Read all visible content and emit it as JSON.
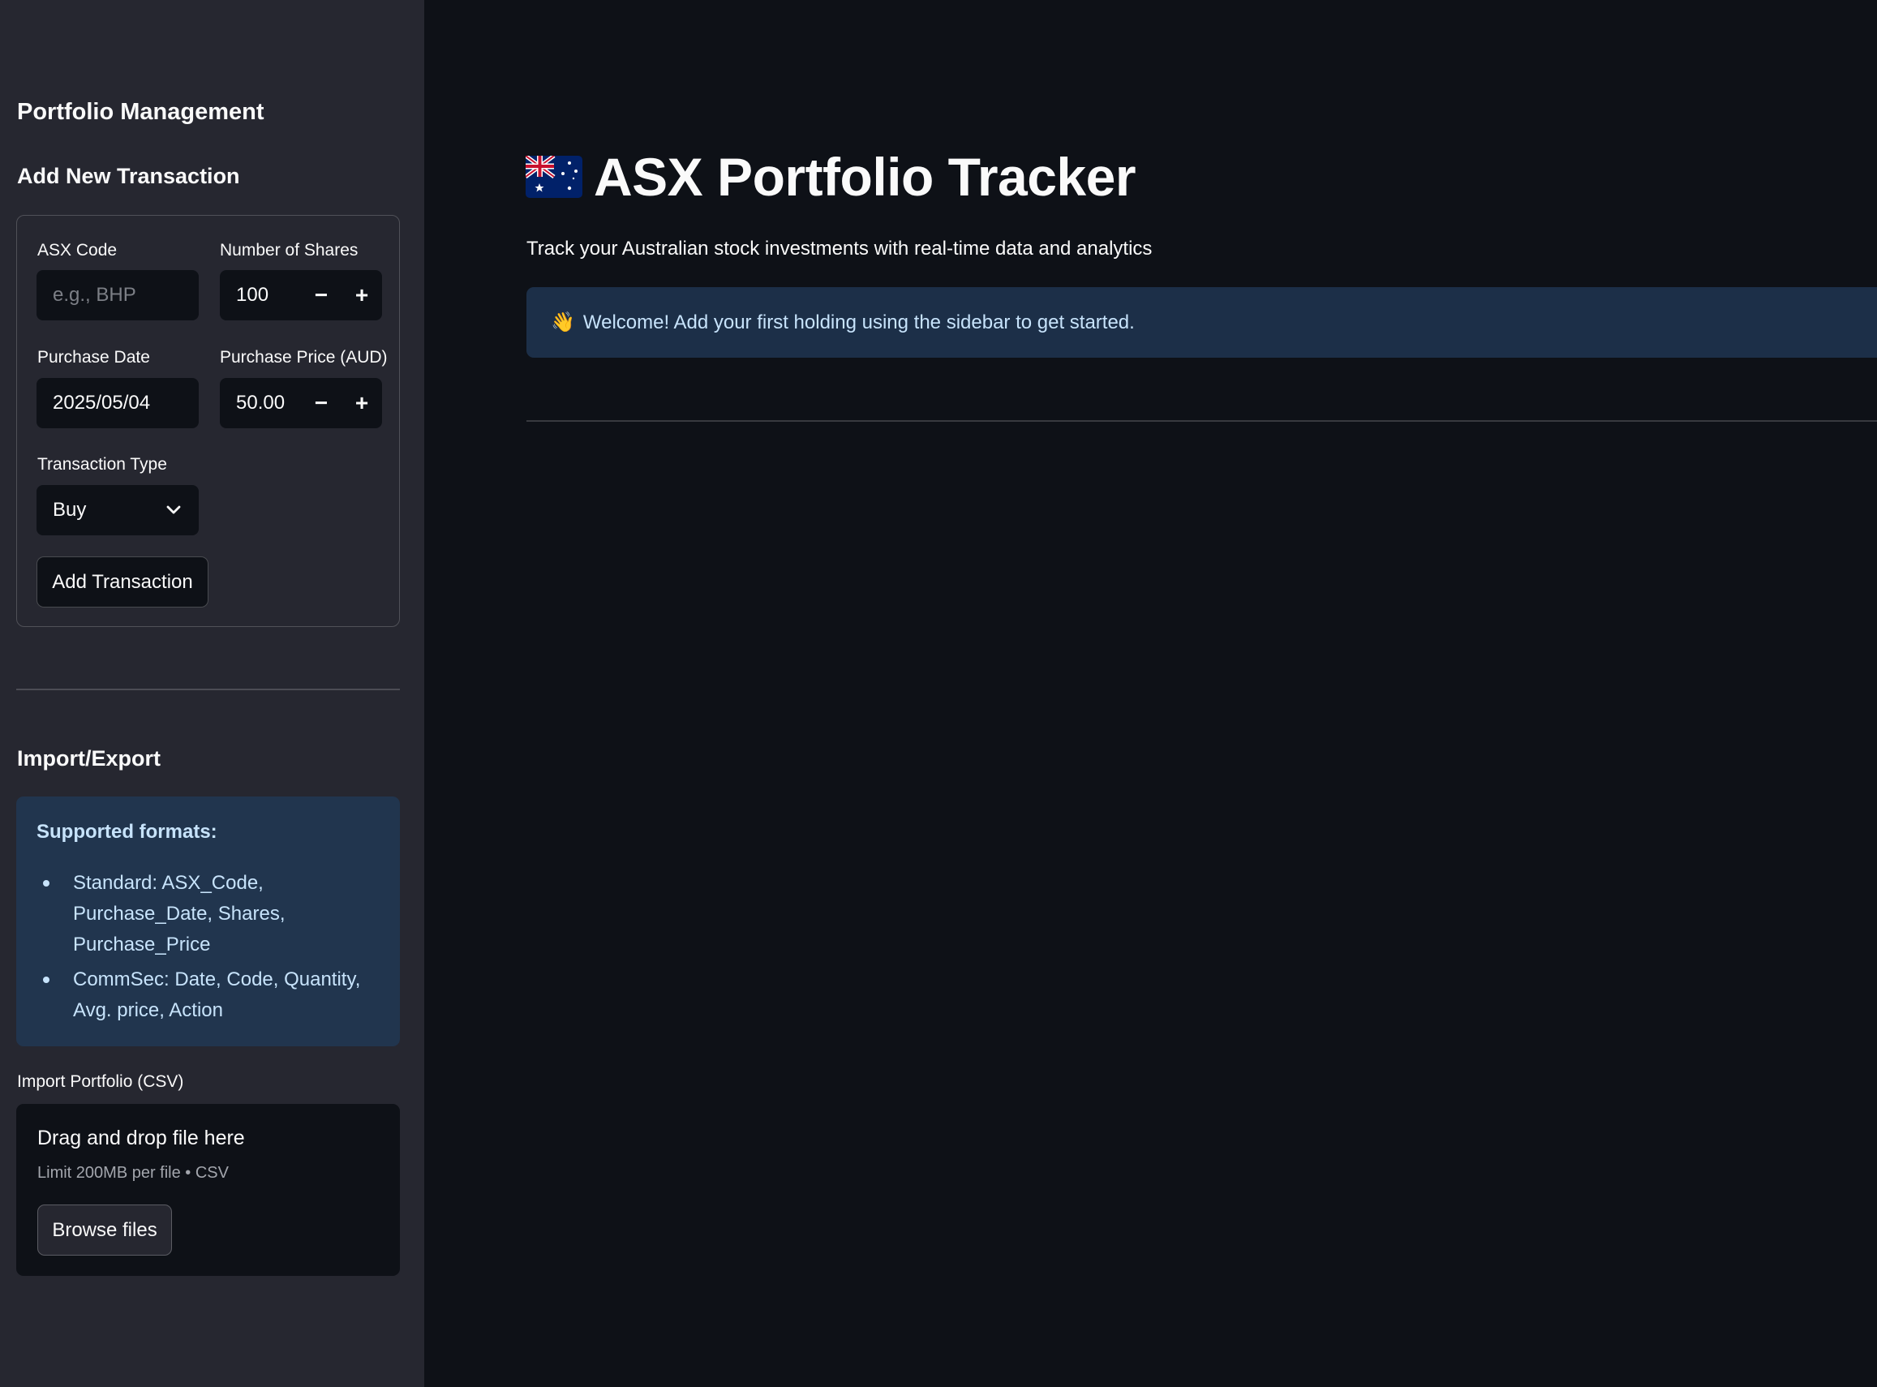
{
  "sidebar": {
    "title": "Portfolio Management",
    "add_section_title": "Add New Transaction",
    "form": {
      "asx_code": {
        "label": "ASX Code",
        "placeholder": "e.g., BHP",
        "value": ""
      },
      "shares": {
        "label": "Number of Shares",
        "value": "100",
        "minus": "−",
        "plus": "+"
      },
      "purchase_date": {
        "label": "Purchase Date",
        "value": "2025/05/04"
      },
      "purchase_price": {
        "label": "Purchase Price (AUD)",
        "value": "50.00",
        "minus": "−",
        "plus": "+"
      },
      "transaction_type": {
        "label": "Transaction Type",
        "value": "Buy"
      },
      "submit_label": "Add Transaction"
    },
    "import_export": {
      "title": "Import/Export",
      "info_heading": "Supported formats:",
      "formats": [
        "Standard: ASX_Code, Purchase_Date, Shares, Purchase_Price",
        "CommSec: Date, Code, Quantity, Avg. price, Action"
      ],
      "upload_label": "Import Portfolio (CSV)",
      "dropzone_title": "Drag and drop file here",
      "dropzone_limit": "Limit 200MB per file • CSV",
      "browse_label": "Browse files"
    }
  },
  "main": {
    "title": "ASX Portfolio Tracker",
    "flag_icon": "australia-flag-icon",
    "description": "Track your Australian stock investments with real-time data and analytics",
    "welcome_emoji": "👋",
    "welcome_text": "Welcome! Add your first holding using the sidebar to get started."
  },
  "colors": {
    "background": "#0e1117",
    "sidebar": "#262730",
    "info_box": "#1c2f48",
    "info_text": "#c7e3fb"
  }
}
